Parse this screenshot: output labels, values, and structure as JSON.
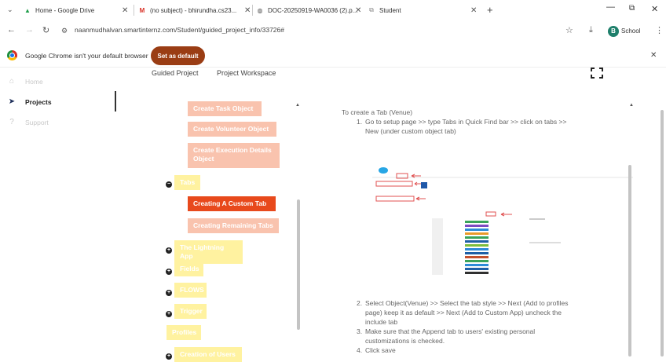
{
  "tabs": [
    {
      "title": "Home - Google Drive",
      "favicon": "google-drive-icon"
    },
    {
      "title": "(no subject) - bhirundha.cs23...",
      "favicon": "gmail-icon"
    },
    {
      "title": "DOC-20250919-WA0036 (2).p...",
      "favicon": "globe-icon"
    },
    {
      "title": "Student",
      "favicon": "page-icon"
    }
  ],
  "new_tab_symbol": "+",
  "url": "naanmudhalvan.smartinternz.com/Student/guided_project_info/33726#",
  "profile": {
    "initial": "B",
    "label": "School"
  },
  "banner": {
    "message": "Google Chrome isn't your default browser",
    "button": "Set as default",
    "button_color": "#9a3d14"
  },
  "page_tabs": [
    "Guided Project",
    "Project Workspace"
  ],
  "sidebar": [
    {
      "label": "Home",
      "icon": "home-icon"
    },
    {
      "label": "Projects",
      "icon": "paper-plane-icon"
    },
    {
      "label": "Support",
      "icon": "question-icon"
    }
  ],
  "tree": {
    "object_items": [
      "Create Task Object",
      "Create Volunteer Object",
      "Create Execution Details Object"
    ],
    "tabs_node": "Tabs",
    "tab_items": [
      "Creating A Custom Tab",
      "Creating Remaining Tabs"
    ],
    "sections": [
      "The Lightning App",
      "Fields",
      "FLOWS",
      "Trigger"
    ],
    "profiles": "Profiles",
    "last": "Creation of Users"
  },
  "content": {
    "heading": "To create a Tab (Venue)",
    "step1": "Go to setup page >> type Tabs in Quick Find bar >> click on tabs >> New (under custom object tab)",
    "step2": "Select Object(Venue) >> Select the tab style >> Next (Add to profiles page) keep it as default >> Next (Add to Custom App) uncheck the include tab",
    "step3": "Make sure that the Append tab to users' existing personal customizations is checked.",
    "step4": "Click save"
  },
  "colors": {
    "active": "#e8491c",
    "salmon": "#f9c3ae",
    "yellow": "#fff2a0",
    "arrow": "#e05050"
  }
}
